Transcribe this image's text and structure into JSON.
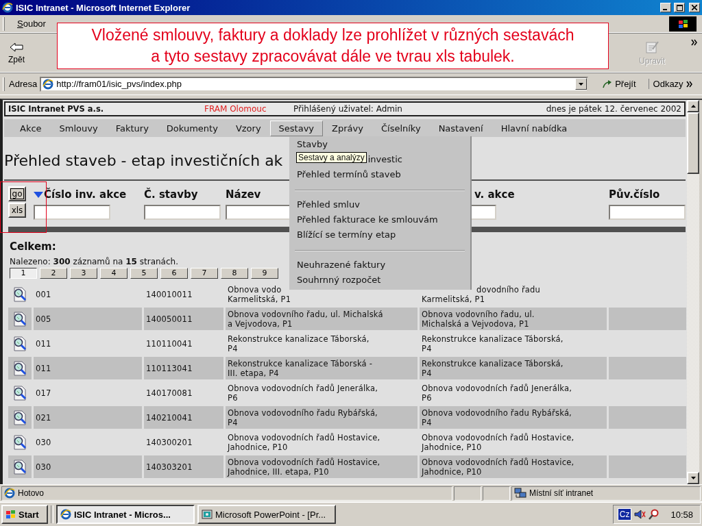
{
  "window": {
    "title": "ISIC Intranet - Microsoft Internet Explorer"
  },
  "menu_bar": [
    {
      "label": "Soubor"
    }
  ],
  "toolbar": [
    {
      "kind": "back",
      "label": "Zpět",
      "disabled": false
    },
    {
      "kind": "edit",
      "label": "Upravit",
      "disabled": true
    }
  ],
  "callout": {
    "text": "Vložené smlouvy, faktury a doklady lze prohlížet v různých sestavách\na tyto sestavy zpracovávat dále ve tvrau xls tabulek."
  },
  "address_bar": {
    "label": "Adresa",
    "value": "http://fram01/isic_pvs/index.php",
    "go": "Přejít",
    "links": "Odkazy"
  },
  "page": {
    "company": "ISIC Intranet PVS a.s.",
    "branch": "FRAM Olomouc",
    "user": "Přihlášený uživatel: Admin",
    "date": "dnes je pátek 12. červenec 2002",
    "nav": [
      {
        "label": "Akce",
        "selected": false
      },
      {
        "label": "Smlouvy",
        "selected": false
      },
      {
        "label": "Faktury",
        "selected": false
      },
      {
        "label": "Dokumenty",
        "selected": false
      },
      {
        "label": "Vzory",
        "selected": false
      },
      {
        "label": "Sestavy",
        "selected": true
      },
      {
        "label": "Zprávy",
        "selected": false
      },
      {
        "label": "Číselníky",
        "selected": false
      },
      {
        "label": "Nastavení",
        "selected": false
      },
      {
        "label": "Hlavní nabídka",
        "selected": false
      }
    ],
    "title": "Přehled staveb - etap investičních ak",
    "buttons": [
      "go",
      "xls"
    ],
    "filter_columns": [
      {
        "label": "Číslo inv. akce",
        "sorted": true
      },
      {
        "label": "Č. stavby",
        "sorted": false
      },
      {
        "label": "Název",
        "sorted": false
      },
      {
        "label": "v. akce",
        "sorted": false
      },
      {
        "label": "Pův.číslo",
        "sorted": false
      }
    ],
    "total_label": "Celkem:",
    "found": "Nalezeno: **300** záznamů na **15** stranách.",
    "pages": [
      {
        "label": "1",
        "selected": true
      },
      {
        "label": "2",
        "selected": false
      },
      {
        "label": "3",
        "selected": false
      },
      {
        "label": "4",
        "selected": false
      },
      {
        "label": "5",
        "selected": false
      },
      {
        "label": "6",
        "selected": false
      },
      {
        "label": "7",
        "selected": false
      },
      {
        "label": "8",
        "selected": false
      },
      {
        "label": "9",
        "selected": false
      }
    ],
    "rows": [
      {
        "number": "001",
        "building": "140010011",
        "name": "Obnova vodo\nKarmelitská, P1",
        "name_2": "dovodního řadu\nKarmelitská, P1"
      },
      {
        "number": "005",
        "building": "140050011",
        "name": "Obnova vodovního řadu, ul. Michalská\na Vejvodova, P1",
        "name_2": "Obnova vodovního řadu, ul.\nMichalská a Vejvodova, P1"
      },
      {
        "number": "011",
        "building": "110110041",
        "name": "Rekonstrukce kanalizace Táborská,\nP4",
        "name_2": "Rekonstrukce kanalizace Táborská,\nP4"
      },
      {
        "number": "011",
        "building": "110113041",
        "name": "Rekonstrukce kanalizace Táborská -\nIII. etapa, P4",
        "name_2": "Rekonstrukce kanalizace Táborská,\nP4"
      },
      {
        "number": "017",
        "building": "140170081",
        "name": "Obnova vodovodních řadů Jenerálka,\nP6",
        "name_2": "Obnova vodovodních řadů Jenerálka,\nP6"
      },
      {
        "number": "021",
        "building": "140210041",
        "name": "Obnova vodovodního řadu Rybářská,\nP4",
        "name_2": "Obnova vodovodního řadu Rybářská,\nP4"
      },
      {
        "number": "030",
        "building": "140300201",
        "name": "Obnova vodovodních řadů Hostavice,\nJahodnice, P10",
        "name_2": "Obnova vodovodních řadů Hostavice,\nJahodnice, P10"
      },
      {
        "number": "030",
        "building": "140303201",
        "name": "Obnova vodovodních řadů Hostavice,\nJahodnice, III. etapa, P10",
        "name_2": "Obnova vodovodních řadů Hostavice,\nJahodnice, P10"
      }
    ],
    "menu": [
      {
        "kind": "item",
        "label": "Stavby"
      },
      {
        "kind": "item",
        "label": "investic",
        "tooltip": "Sestavy a analýzy"
      },
      {
        "kind": "item",
        "label": "Přehled termínů staveb"
      },
      {
        "kind": "separator"
      },
      {
        "kind": "item",
        "label": "Přehled smluv"
      },
      {
        "kind": "item",
        "label": "Přehled fakturace ke smlouvám"
      },
      {
        "kind": "item",
        "label": "Blížící se termíny etap"
      },
      {
        "kind": "separator"
      },
      {
        "kind": "item",
        "label": "Neuhrazené faktury"
      },
      {
        "kind": "item",
        "label": "Souhrnný rozpočet"
      }
    ]
  },
  "status_bar": {
    "text": "Hotovo",
    "zone": "Místní síť intranet"
  },
  "taskbar": {
    "start": "Start",
    "tasks": [
      {
        "kind": "browser",
        "label": "ISIC Intranet - Micros...",
        "selected": true
      },
      {
        "kind": "slides",
        "label": "Microsoft PowerPoint - [Pr...",
        "selected": false
      }
    ],
    "language": "Cz",
    "time": "10:58"
  }
}
